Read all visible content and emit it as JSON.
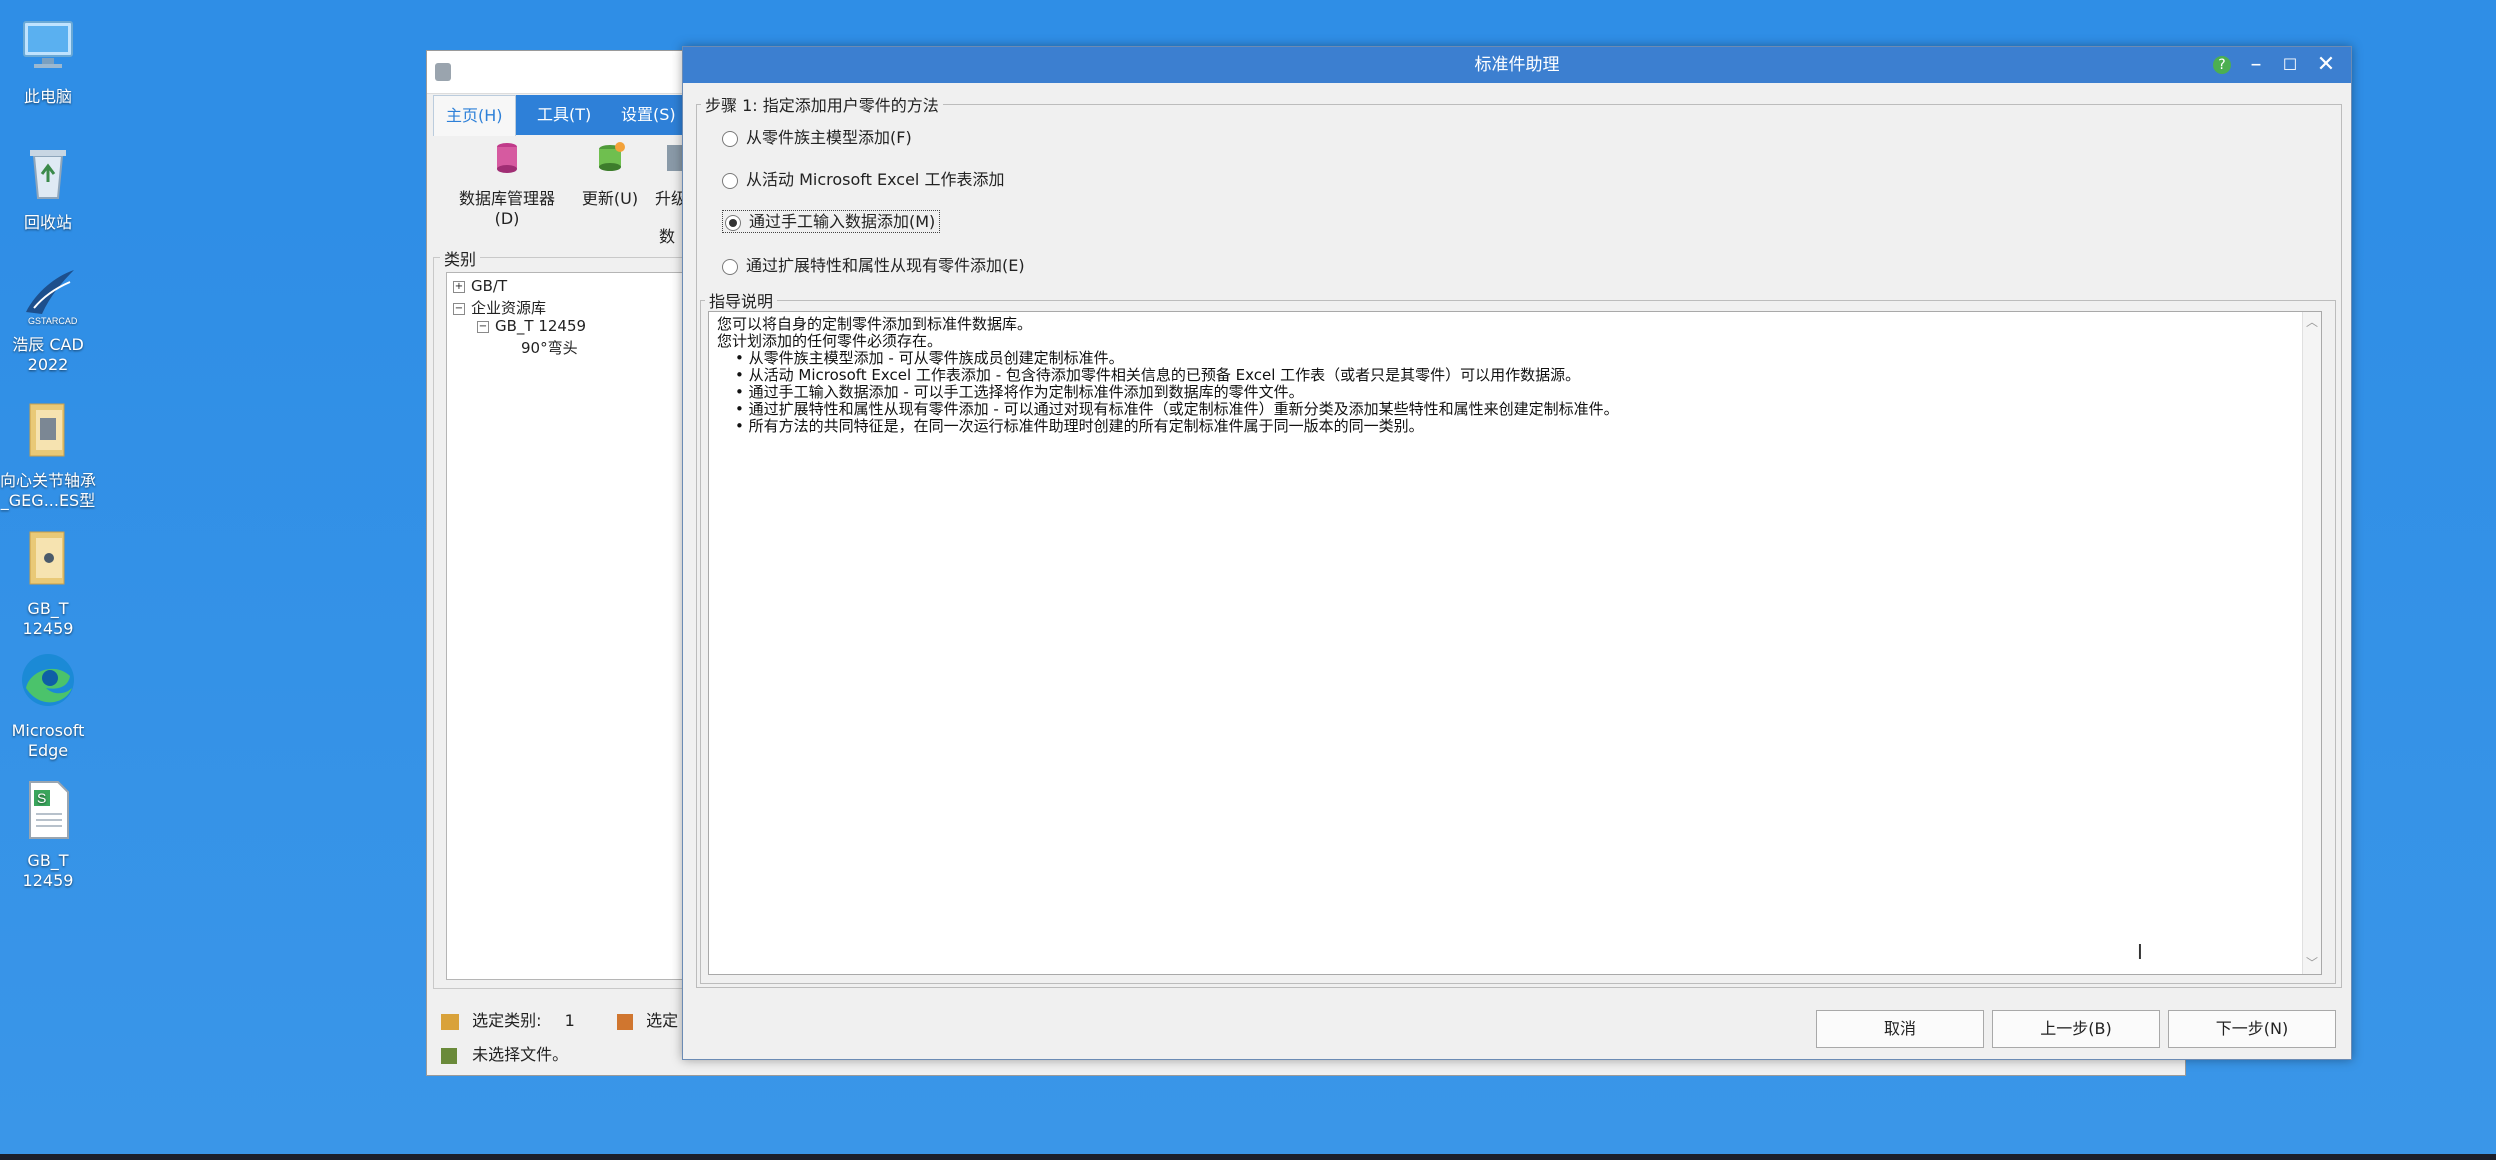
{
  "desktop": {
    "icons": [
      {
        "label": "此电脑",
        "name": "this-pc-icon"
      },
      {
        "label": "回收站",
        "name": "recycle-bin-icon"
      },
      {
        "label": "浩辰 CAD 2022",
        "name": "gstarcad-icon"
      },
      {
        "label": "向心关节轴承_GEG...ES型",
        "name": "folder-icon"
      },
      {
        "label": "GB_T 12459",
        "name": "folder-icon"
      },
      {
        "label": "Microsoft Edge",
        "name": "edge-icon"
      },
      {
        "label": "GB_T 12459",
        "name": "spreadsheet-file-icon"
      }
    ]
  },
  "main_window": {
    "tabs": [
      {
        "label": "主页(H)"
      },
      {
        "label": "工具(T)"
      },
      {
        "label": "设置(S)"
      }
    ],
    "ribbon_buttons": [
      {
        "label": "数据库管理器(D)"
      },
      {
        "label": "更新(U)"
      },
      {
        "label": "升级"
      }
    ],
    "group_label_partial": "数",
    "category_title": "类别",
    "tree": [
      {
        "label": "GB/T"
      },
      {
        "label": "企业资源库"
      },
      {
        "label": "GB_T 12459"
      },
      {
        "label": "90°弯头"
      }
    ],
    "status": {
      "selected_category_label": "选定类别:",
      "selected_category_value": "1",
      "selected_partial": "选定",
      "no_file": "未选择文件。"
    }
  },
  "dialog": {
    "title": "标准件助理",
    "step_title": "步骤 1: 指定添加用户零件的方法",
    "options": [
      {
        "label": "从零件族主模型添加(F)",
        "selected": false
      },
      {
        "label": "从活动 Microsoft Excel 工作表添加",
        "selected": false
      },
      {
        "label": "通过手工输入数据添加(M)",
        "selected": true
      },
      {
        "label": "通过扩展特性和属性从现有零件添加(E)",
        "selected": false
      }
    ],
    "guide_title": "指导说明",
    "guide_lines": [
      "您可以将自身的定制零件添加到标准件数据库。",
      "您计划添加的任何零件必须存在。"
    ],
    "guide_bullets": [
      "从零件族主模型添加 - 可从零件族成员创建定制标准件。",
      "从活动 Microsoft Excel 工作表添加 - 包含待添加零件相关信息的已预备 Excel 工作表（或者只是其零件）可以用作数据源。",
      "通过手工输入数据添加 - 可以手工选择将作为定制标准件添加到数据库的零件文件。",
      "通过扩展特性和属性从现有零件添加 - 可以通过对现有标准件（或定制标准件）重新分类及添加某些特性和属性来创建定制标准件。",
      "所有方法的共同特征是，在同一次运行标准件助理时创建的所有定制标准件属于同一版本的同一类别。"
    ],
    "buttons": {
      "cancel": "取消",
      "back": "上一步(B)",
      "next": "下一步(N)"
    },
    "colors": {
      "title_bar": "#3c7fd0",
      "help": "#4caf50"
    }
  }
}
